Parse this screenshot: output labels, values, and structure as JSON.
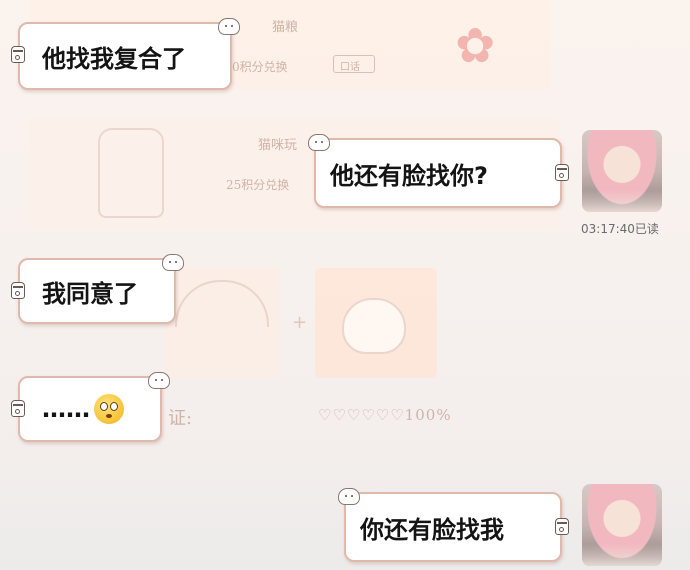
{
  "wallpaper": {
    "text_food": "猫粮",
    "text_points_1": "0积分兑换",
    "text_btn": "口话",
    "text_toy": "猫咪玩",
    "text_points_2": "25积分兑换",
    "text_verify": "证:",
    "text_hearts": "♡♡♡♡♡♡100%"
  },
  "messages": [
    {
      "side": "left",
      "text": "他找我复合了"
    },
    {
      "side": "right",
      "text": "他还有脸找你?",
      "read_status": "03:17:40已读"
    },
    {
      "side": "left",
      "text": "我同意了"
    },
    {
      "side": "left",
      "text": "……",
      "emoji": "flushed-face-emoji"
    },
    {
      "side": "right",
      "text": "你还有脸找我"
    }
  ],
  "colors": {
    "bubble_border": "#e0b9ad",
    "bubble_bg": "#ffffff",
    "text": "#141414"
  }
}
